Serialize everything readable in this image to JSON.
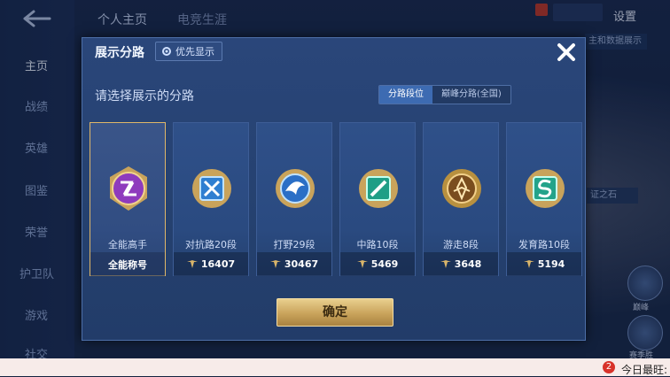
{
  "background": {
    "top_tabs": [
      "个人主页",
      "电竞生涯"
    ],
    "settings_label": "设置",
    "nav_items": [
      "主页",
      "战绩",
      "英雄",
      "图鉴",
      "荣誉",
      "护卫队",
      "游戏",
      "社交"
    ],
    "right_panel": {
      "strip_text": "主和数据展示",
      "badge_text": "证之石",
      "circle_caption_1": "巅峰",
      "circle_caption_2": "赛季胜"
    }
  },
  "notification": {
    "badge_count": "2",
    "text": "今日最旺:"
  },
  "dialog": {
    "title": "展示分路",
    "priority_button": "优先显示",
    "subtitle": "请选择展示的分路",
    "segments": [
      {
        "label": "分路段位",
        "active": true
      },
      {
        "label": "巅峰分路(全国)",
        "active": false
      }
    ],
    "cards": [
      {
        "label": "全能高手",
        "footer": "全能称号",
        "selected": true,
        "emblem": "purple-allround",
        "has_score_icon": false
      },
      {
        "label": "对抗路20段",
        "footer": "16407",
        "selected": false,
        "emblem": "blue-x",
        "has_score_icon": true
      },
      {
        "label": "打野29段",
        "footer": "30467",
        "selected": false,
        "emblem": "blue-wing",
        "has_score_icon": true
      },
      {
        "label": "中路10段",
        "footer": "5469",
        "selected": false,
        "emblem": "teal-slash",
        "has_score_icon": true
      },
      {
        "label": "游走8段",
        "footer": "3648",
        "selected": false,
        "emblem": "gold-support",
        "has_score_icon": true
      },
      {
        "label": "发育路10段",
        "footer": "5194",
        "selected": false,
        "emblem": "green-s",
        "has_score_icon": true
      }
    ],
    "confirm_button": "确定",
    "colors": {
      "selected_border": "#e0b768",
      "confirm_gold": "#c9a35b",
      "segment_active": "#3d6bb2"
    }
  }
}
